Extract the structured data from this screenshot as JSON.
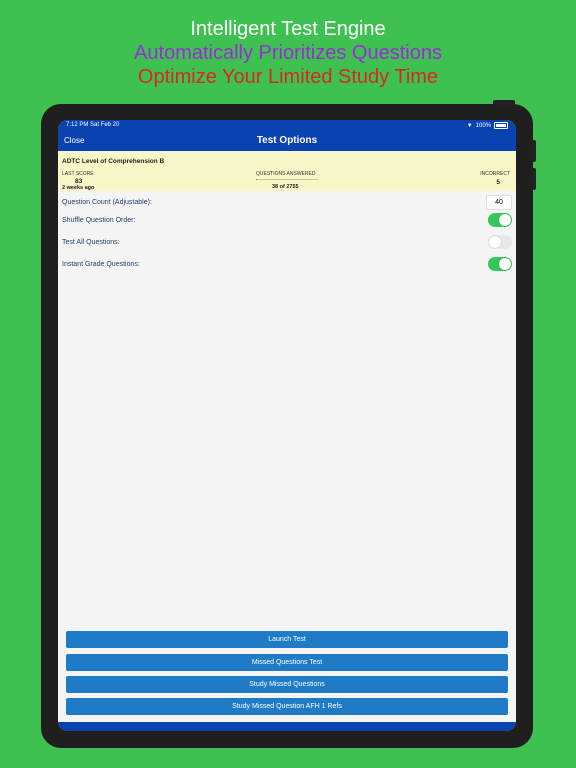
{
  "promo": {
    "line1": "Intelligent Test Engine",
    "line2": "Automatically Prioritizes Questions",
    "line3": "Optimize Your Limited Study Time"
  },
  "status_bar": {
    "time": "7:12 PM",
    "date": "Sat Feb 20",
    "battery": "100%"
  },
  "nav": {
    "close_label": "Close",
    "title": "Test Options"
  },
  "summary": {
    "title": "ADTC Level of Comprehension B",
    "last_score_label": "LAST SCORE",
    "last_score": "83",
    "last_score_age": "2 weeks ago",
    "questions_answered_label": "QUESTIONS ANSWERED",
    "questions_answered": "38 of 2755",
    "questions_answered_fraction": 0.0138,
    "incorrect_label": "INCORRECT",
    "incorrect": "5"
  },
  "options": [
    {
      "label": "Question Count (Adjustable):",
      "type": "number",
      "value": "40"
    },
    {
      "label": "Shuffle Question Order:",
      "type": "toggle",
      "on": true
    },
    {
      "label": "Test All Questions:",
      "type": "toggle",
      "on": false
    },
    {
      "label": "Instant Grade Questions:",
      "type": "toggle",
      "on": true
    }
  ],
  "actions": {
    "launch": "Launch Test",
    "missed": "Missed Questions Test",
    "study_missed": "Study Missed Questions",
    "study_missed_refs": "Study Missed Question AFH 1 Refs"
  },
  "colors": {
    "background": "#3fc152",
    "nav_blue": "#0a42b0",
    "button_blue": "#1f7bc6",
    "toggle_on": "#34c759",
    "summary_bg": "#f7f6c7"
  }
}
